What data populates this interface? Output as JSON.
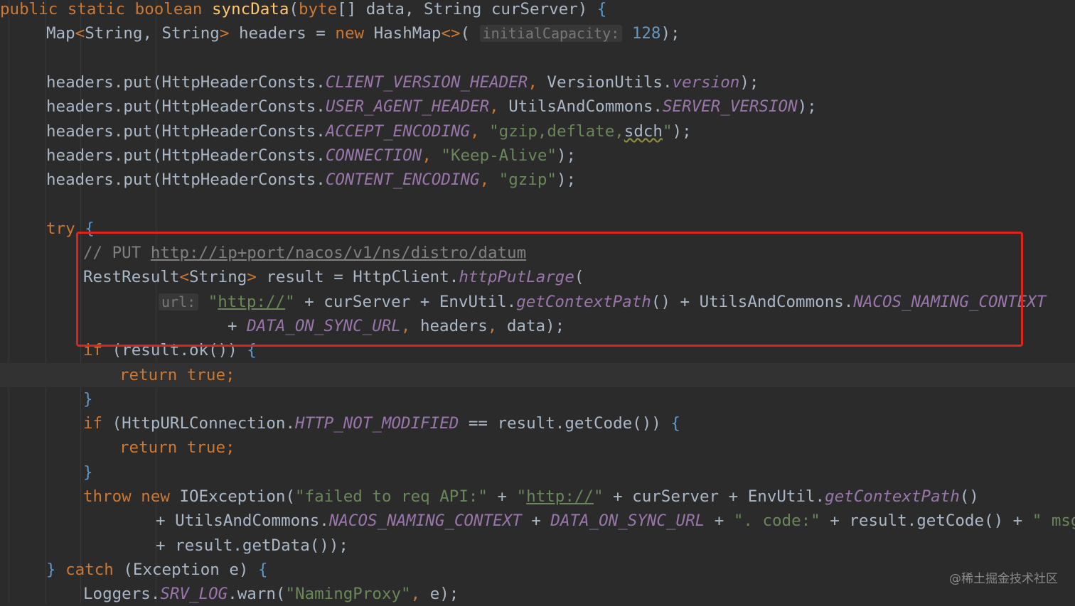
{
  "code": {
    "lines": [
      {
        "indent": 0,
        "segs": [
          [
            "kw",
            "public static boolean "
          ],
          [
            "fn",
            "syncData"
          ],
          [
            "ty",
            "("
          ],
          [
            "kw",
            "byte"
          ],
          [
            "ty",
            "[] data, String curServer) "
          ],
          [
            "br2",
            "{"
          ]
        ]
      },
      {
        "indent": 65,
        "segs": [
          [
            "ty",
            "Map"
          ],
          [
            "kw",
            "<"
          ],
          [
            "ty",
            "String, String"
          ],
          [
            "kw",
            "> "
          ],
          [
            "ty",
            "headers = "
          ],
          [
            "kw",
            "new "
          ],
          [
            "ty",
            "HashMap"
          ],
          [
            "kw",
            "<>"
          ],
          [
            "ty",
            "( "
          ],
          [
            "hint",
            "initialCapacity:"
          ],
          [
            "ty",
            " "
          ],
          [
            "num",
            "128"
          ],
          [
            "ty",
            ");"
          ]
        ]
      },
      {
        "indent": 65,
        "segs": []
      },
      {
        "indent": 65,
        "segs": [
          [
            "ty",
            "headers.put(HttpHeaderConsts."
          ],
          [
            "it",
            "CLIENT_VERSION_HEADER"
          ],
          [
            "kw",
            ", "
          ],
          [
            "ty",
            "VersionUtils."
          ],
          [
            "it",
            "version"
          ],
          [
            "ty",
            ");"
          ]
        ]
      },
      {
        "indent": 65,
        "segs": [
          [
            "ty",
            "headers.put(HttpHeaderConsts."
          ],
          [
            "it",
            "USER_AGENT_HEADER"
          ],
          [
            "kw",
            ", "
          ],
          [
            "ty",
            "UtilsAndCommons."
          ],
          [
            "it",
            "SERVER_VERSION"
          ],
          [
            "ty",
            ");"
          ]
        ]
      },
      {
        "indent": 65,
        "segs": [
          [
            "ty",
            "headers.put(HttpHeaderConsts."
          ],
          [
            "it",
            "ACCEPT_ENCODING"
          ],
          [
            "kw",
            ", "
          ],
          [
            "st",
            "\"gzip,deflate,"
          ],
          [
            "sq",
            "sdch"
          ],
          [
            "st",
            "\""
          ],
          [
            "ty",
            ");"
          ]
        ]
      },
      {
        "indent": 65,
        "segs": [
          [
            "ty",
            "headers.put(HttpHeaderConsts."
          ],
          [
            "it",
            "CONNECTION"
          ],
          [
            "kw",
            ", "
          ],
          [
            "st",
            "\"Keep-Alive\""
          ],
          [
            "ty",
            ");"
          ]
        ]
      },
      {
        "indent": 65,
        "segs": [
          [
            "ty",
            "headers.put(HttpHeaderConsts."
          ],
          [
            "it",
            "CONTENT_ENCODING"
          ],
          [
            "kw",
            ", "
          ],
          [
            "st",
            "\"gzip\""
          ],
          [
            "ty",
            ");"
          ]
        ]
      },
      {
        "indent": 65,
        "segs": []
      },
      {
        "indent": 65,
        "segs": [
          [
            "kw",
            "try "
          ],
          [
            "br2",
            "{"
          ]
        ]
      },
      {
        "indent": 117,
        "segs": [
          [
            "cm",
            "// PUT "
          ],
          [
            "url",
            "http://ip+port/nacos/v1/ns/distro/datum"
          ]
        ]
      },
      {
        "indent": 117,
        "segs": [
          [
            "ty",
            "RestResult"
          ],
          [
            "kw",
            "<"
          ],
          [
            "ty",
            "String"
          ],
          [
            "kw",
            "> "
          ],
          [
            "ty",
            "result = HttpClient."
          ],
          [
            "it",
            "httpPutLarge"
          ],
          [
            "ty",
            "("
          ]
        ]
      },
      {
        "indent": 223,
        "segs": [
          [
            "hint",
            "url:"
          ],
          [
            "ty",
            " "
          ],
          [
            "st",
            "\""
          ],
          [
            "surl",
            "http://"
          ],
          [
            "st",
            "\""
          ],
          [
            "ty",
            " + curServer + EnvUtil."
          ],
          [
            "it",
            "getContextPath"
          ],
          [
            "ty",
            "() + UtilsAndCommons."
          ],
          [
            "it",
            "NACOS_NAMING_CONTEXT"
          ]
        ]
      },
      {
        "indent": 320,
        "segs": [
          [
            "ty",
            "+ "
          ],
          [
            "it",
            "DATA_ON_SYNC_URL"
          ],
          [
            "kw",
            ", "
          ],
          [
            "ty",
            "headers"
          ],
          [
            "kw",
            ", "
          ],
          [
            "ty",
            "data);"
          ]
        ]
      },
      {
        "indent": 117,
        "segs": [
          [
            "kw",
            "if "
          ],
          [
            "ty",
            "(result.ok()) "
          ],
          [
            "br2",
            "{"
          ]
        ]
      },
      {
        "indent": 168,
        "segs": [
          [
            "kw",
            "return true;"
          ]
        ]
      },
      {
        "indent": 117,
        "segs": [
          [
            "br2",
            "}"
          ]
        ]
      },
      {
        "indent": 117,
        "segs": [
          [
            "kw",
            "if "
          ],
          [
            "ty",
            "(HttpURLConnection."
          ],
          [
            "it",
            "HTTP_NOT_MODIFIED"
          ],
          [
            "ty",
            " == result.getCode()) "
          ],
          [
            "br2",
            "{"
          ]
        ]
      },
      {
        "indent": 168,
        "segs": [
          [
            "kw",
            "return true;"
          ]
        ]
      },
      {
        "indent": 117,
        "segs": [
          [
            "br2",
            "}"
          ]
        ]
      },
      {
        "indent": 117,
        "segs": [
          [
            "kw",
            "throw new "
          ],
          [
            "ty",
            "IOException("
          ],
          [
            "st",
            "\"failed to req API:\""
          ],
          [
            "ty",
            " + "
          ],
          [
            "st",
            "\""
          ],
          [
            "surl",
            "http://"
          ],
          [
            "st",
            "\""
          ],
          [
            "ty",
            " + curServer + EnvUtil."
          ],
          [
            "it",
            "getContextPath"
          ],
          [
            "ty",
            "()"
          ]
        ]
      },
      {
        "indent": 219,
        "segs": [
          [
            "ty",
            "+ UtilsAndCommons."
          ],
          [
            "it",
            "NACOS_NAMING_CONTEXT"
          ],
          [
            "ty",
            " + "
          ],
          [
            "it",
            "DATA_ON_SYNC_URL"
          ],
          [
            "ty",
            " + "
          ],
          [
            "st",
            "\". code:\""
          ],
          [
            "ty",
            " + result.getCode() + "
          ],
          [
            "st",
            "\" msg: \""
          ]
        ]
      },
      {
        "indent": 219,
        "segs": [
          [
            "ty",
            "+ result.getData());"
          ]
        ]
      },
      {
        "indent": 65,
        "segs": [
          [
            "br2",
            "} "
          ],
          [
            "kw",
            "catch "
          ],
          [
            "ty",
            "(Exception e) "
          ],
          [
            "br2",
            "{"
          ]
        ]
      },
      {
        "indent": 117,
        "segs": [
          [
            "ty",
            "Loggers."
          ],
          [
            "it",
            "SRV_LOG"
          ],
          [
            "ty",
            ".warn("
          ],
          [
            "st",
            "\"NamingProxy\""
          ],
          [
            "kw",
            ", "
          ],
          [
            "ty",
            "e);"
          ]
        ]
      }
    ]
  },
  "watermark": "@稀土掘金技术社区",
  "colors": {
    "background": "#2b2b2b",
    "keyword": "#cc7832",
    "method_decl": "#ffc66d",
    "static_field": "#9876aa",
    "string": "#6a8759",
    "number": "#6897bb",
    "comment": "#808080",
    "highlight_box": "#e0231d"
  }
}
